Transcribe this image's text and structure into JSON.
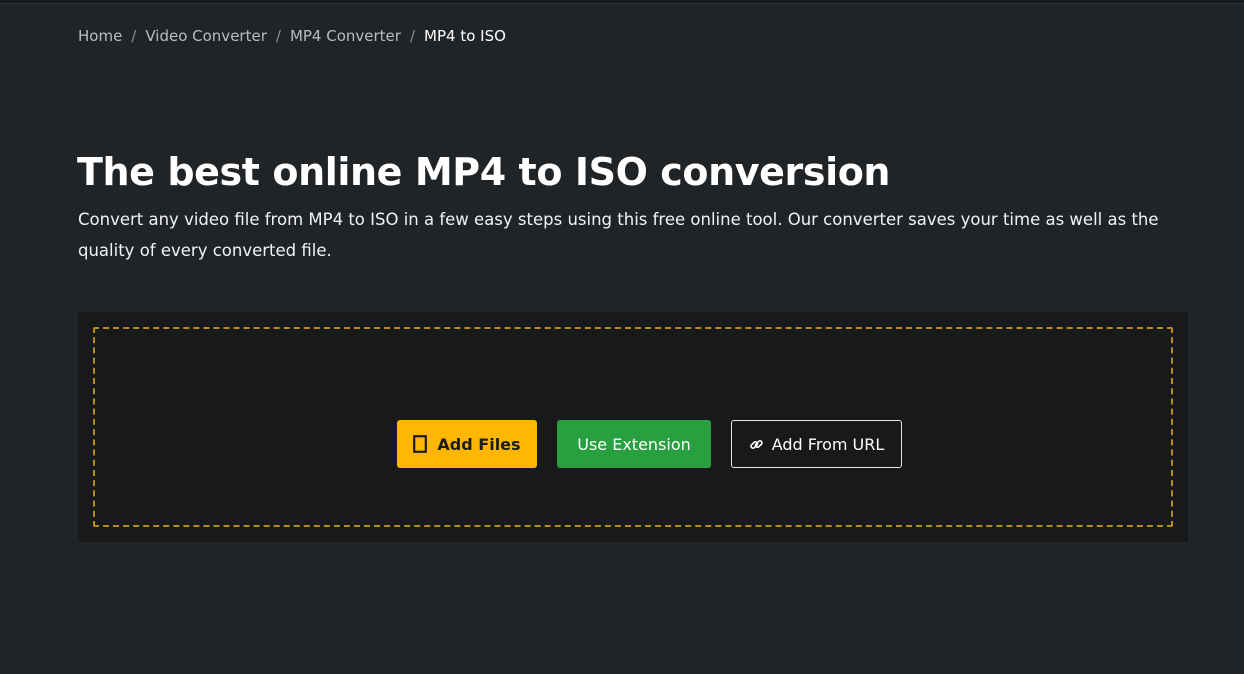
{
  "breadcrumb": {
    "items": [
      {
        "label": "Home"
      },
      {
        "label": "Video Converter"
      },
      {
        "label": "MP4 Converter"
      }
    ],
    "current": "MP4 to ISO",
    "separator": "/"
  },
  "hero": {
    "title": "The best online MP4 to ISO conversion",
    "description": "Convert any video file from MP4 to ISO in a few easy steps using this free online tool. Our converter saves your time as well as the quality of every converted file."
  },
  "upload": {
    "add_files_label": "Add Files",
    "add_files_icon": "file-icon",
    "use_extension_label": "Use Extension",
    "add_url_label": "Add From URL",
    "add_url_icon": "link-icon"
  },
  "colors": {
    "background": "#212427",
    "panel": "#18191b",
    "accent_yellow": "#ffb703",
    "accent_green": "#28a03f",
    "dashed_border": "#b88a1c"
  }
}
